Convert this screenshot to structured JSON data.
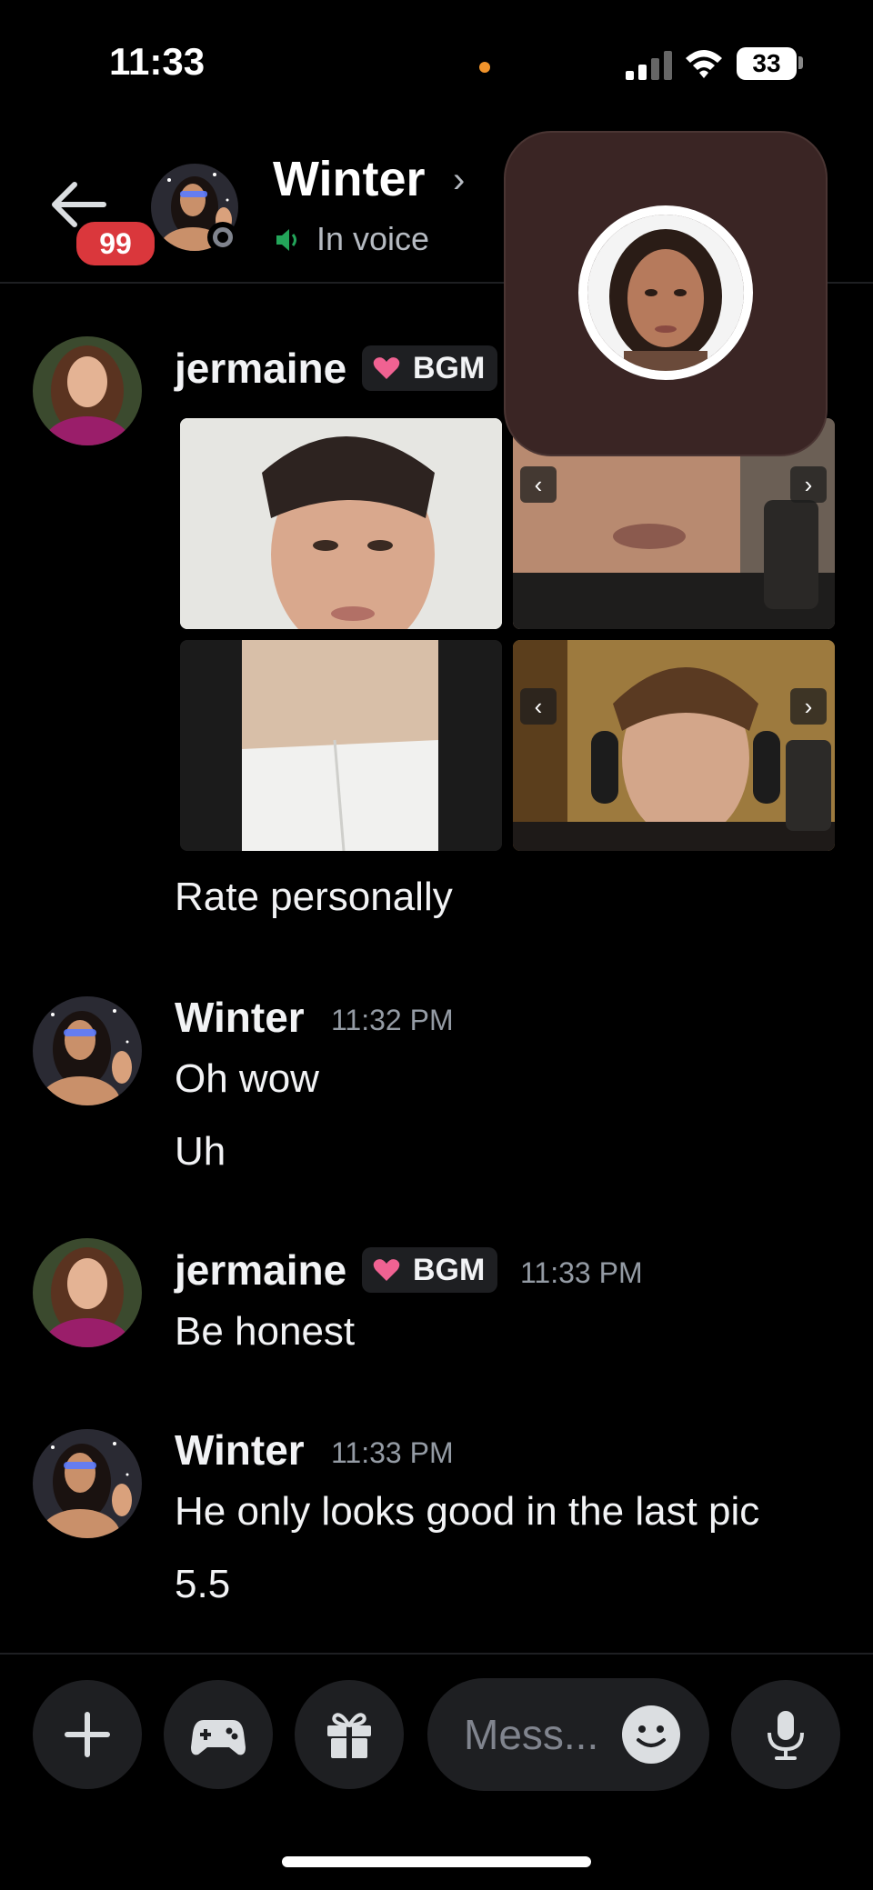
{
  "status_bar": {
    "time": "11:33",
    "battery": "33"
  },
  "header": {
    "unread_badge": "99",
    "title": "Winter",
    "subtitle": "In voice"
  },
  "messages": [
    {
      "author": "jermaine",
      "role_tag": "BGM",
      "timestamp": "",
      "lines": [
        "Rate personally"
      ],
      "has_images": true
    },
    {
      "author": "Winter",
      "timestamp": "11:32 PM",
      "lines": [
        "Oh wow",
        "Uh"
      ]
    },
    {
      "author": "jermaine",
      "role_tag": "BGM",
      "timestamp": "11:33 PM",
      "lines": [
        "Be honest"
      ]
    },
    {
      "author": "Winter",
      "timestamp": "11:33 PM",
      "lines": [
        "He only looks good in the last pic",
        "5.5"
      ]
    }
  ],
  "composer": {
    "placeholder": "Mess..."
  },
  "colors": {
    "background": "#000000",
    "badge": "#da373c",
    "voice_green": "#23a55a",
    "muted_text": "#949ba4",
    "call_bg": "#3a2524"
  },
  "icons": [
    "arrow-left-icon",
    "chevron-right-icon",
    "speaker-icon",
    "heart-icon",
    "plus-icon",
    "gamepad-icon",
    "gift-icon",
    "emoji-icon",
    "microphone-icon",
    "chevron-left-icon"
  ]
}
